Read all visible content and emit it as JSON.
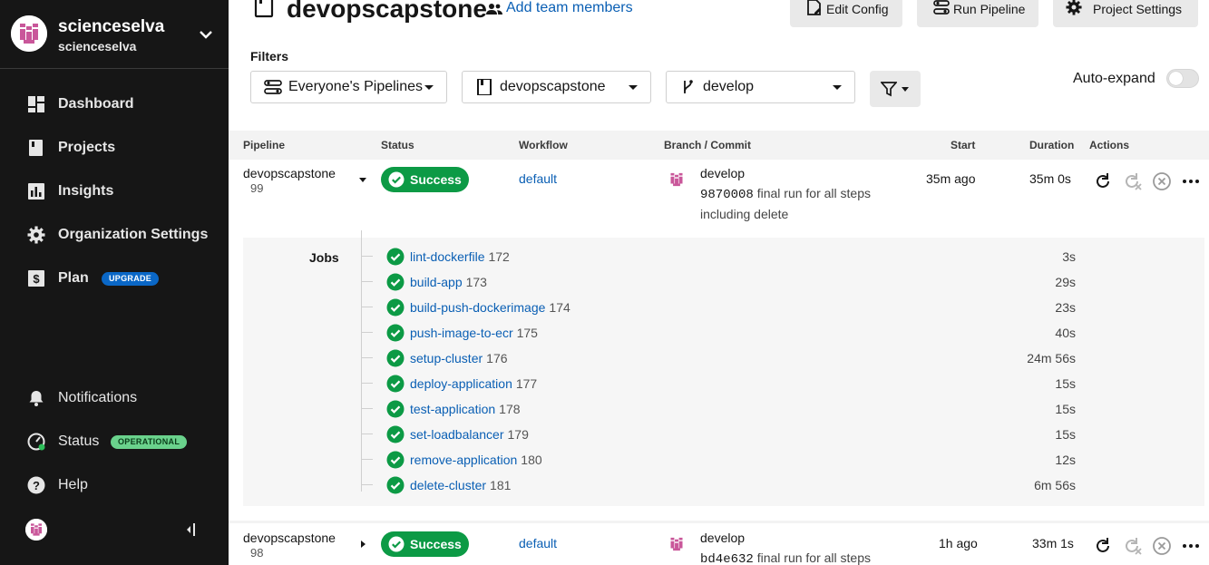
{
  "sidebar": {
    "org_name": "scienceselva",
    "org_sub": "scienceselva",
    "items": [
      {
        "label": "Dashboard",
        "icon": "dashboard-icon"
      },
      {
        "label": "Projects",
        "icon": "projects-icon"
      },
      {
        "label": "Insights",
        "icon": "insights-icon"
      },
      {
        "label": "Organization Settings",
        "icon": "gear-icon"
      },
      {
        "label": "Plan",
        "icon": "dollar-icon",
        "badge": "UPGRADE"
      }
    ],
    "footer": [
      {
        "label": "Notifications",
        "icon": "bell-icon"
      },
      {
        "label": "Status",
        "icon": "status-gauge-icon",
        "badge": "OPERATIONAL"
      },
      {
        "label": "Help",
        "icon": "help-icon"
      }
    ]
  },
  "header": {
    "project_title": "devopscapstone",
    "add_team": "Add team members",
    "edit_config": "Edit Config",
    "run_pipeline": "Run Pipeline",
    "project_settings": "Project Settings"
  },
  "filters": {
    "label": "Filters",
    "pipelines": "Everyone's Pipelines",
    "project": "devopscapstone",
    "branch": "develop",
    "auto_expand": "Auto-expand",
    "auto_expand_on": false
  },
  "table": {
    "headers": [
      "Pipeline",
      "Status",
      "Workflow",
      "Branch / Commit",
      "Start",
      "Duration",
      "Actions"
    ],
    "jobs_label": "Jobs",
    "rows": [
      {
        "pipeline": "devopscapstone",
        "number": "99",
        "status": "Success",
        "workflow": "default",
        "branch": "develop",
        "sha": "9870008",
        "message": "final run for all steps including delete",
        "start": "35m ago",
        "duration": "35m 0s",
        "jobs": [
          {
            "name": "lint-dockerfile",
            "num": "172",
            "duration": "3s"
          },
          {
            "name": "build-app",
            "num": "173",
            "duration": "29s"
          },
          {
            "name": "build-push-dockerimage",
            "num": "174",
            "duration": "23s"
          },
          {
            "name": "push-image-to-ecr",
            "num": "175",
            "duration": "40s"
          },
          {
            "name": "setup-cluster",
            "num": "176",
            "duration": "24m 56s"
          },
          {
            "name": "deploy-application",
            "num": "177",
            "duration": "15s"
          },
          {
            "name": "test-application",
            "num": "178",
            "duration": "15s"
          },
          {
            "name": "set-loadbalancer",
            "num": "179",
            "duration": "15s"
          },
          {
            "name": "remove-application",
            "num": "180",
            "duration": "12s"
          },
          {
            "name": "delete-cluster",
            "num": "181",
            "duration": "6m 56s"
          }
        ]
      },
      {
        "pipeline": "devopscapstone",
        "number": "98",
        "status": "Success",
        "workflow": "default",
        "branch": "develop",
        "sha": "bd4e632",
        "message": "final run for all steps",
        "start": "1h ago",
        "duration": "33m 1s"
      }
    ]
  },
  "colors": {
    "sidebar_bg": "#161616",
    "success": "#0c9a45",
    "link": "#0a5fb4",
    "upgrade_badge": "#0a67c6",
    "operational_badge": "#6ad28c",
    "avatar_pink": "#c9579a"
  }
}
